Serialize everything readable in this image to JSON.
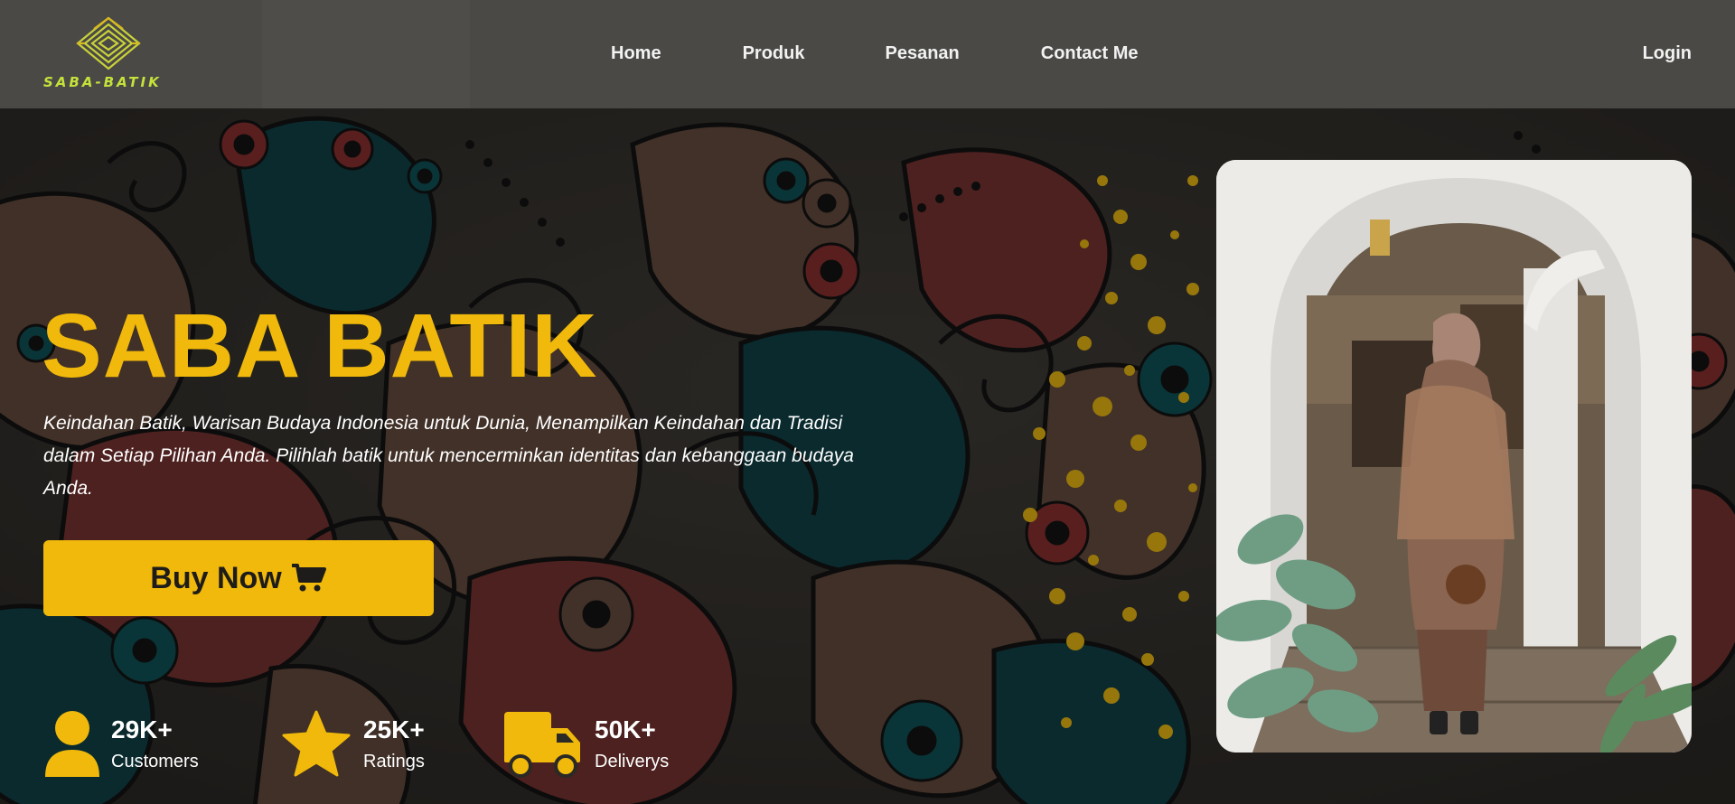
{
  "brand": {
    "logo_text": "SABA-BATIK",
    "logo_icon": "diamond-maze-logo-icon"
  },
  "nav": {
    "links": [
      "Home",
      "Produk",
      "Pesanan",
      "Contact Me"
    ],
    "login": "Login"
  },
  "hero": {
    "title": "SABA BATIK",
    "description": "Keindahan Batik, Warisan Budaya Indonesia untuk Dunia, Menampilkan Keindahan dan Tradisi dalam Setiap Pilihan Anda. Pilihlah batik untuk mencerminkan identitas dan kebanggaan budaya Anda.",
    "buy_label": "Buy Now",
    "buy_icon": "shopping-cart-icon"
  },
  "stats": [
    {
      "value": "29K+",
      "label": "Customers",
      "icon": "user-icon"
    },
    {
      "value": "25K+",
      "label": "Ratings",
      "icon": "star-icon"
    },
    {
      "value": "50K+",
      "label": "Deliverys",
      "icon": "truck-icon"
    }
  ],
  "colors": {
    "accent": "#f0b90b",
    "logo": "#c4e23a",
    "navbar": "#4a4946"
  }
}
